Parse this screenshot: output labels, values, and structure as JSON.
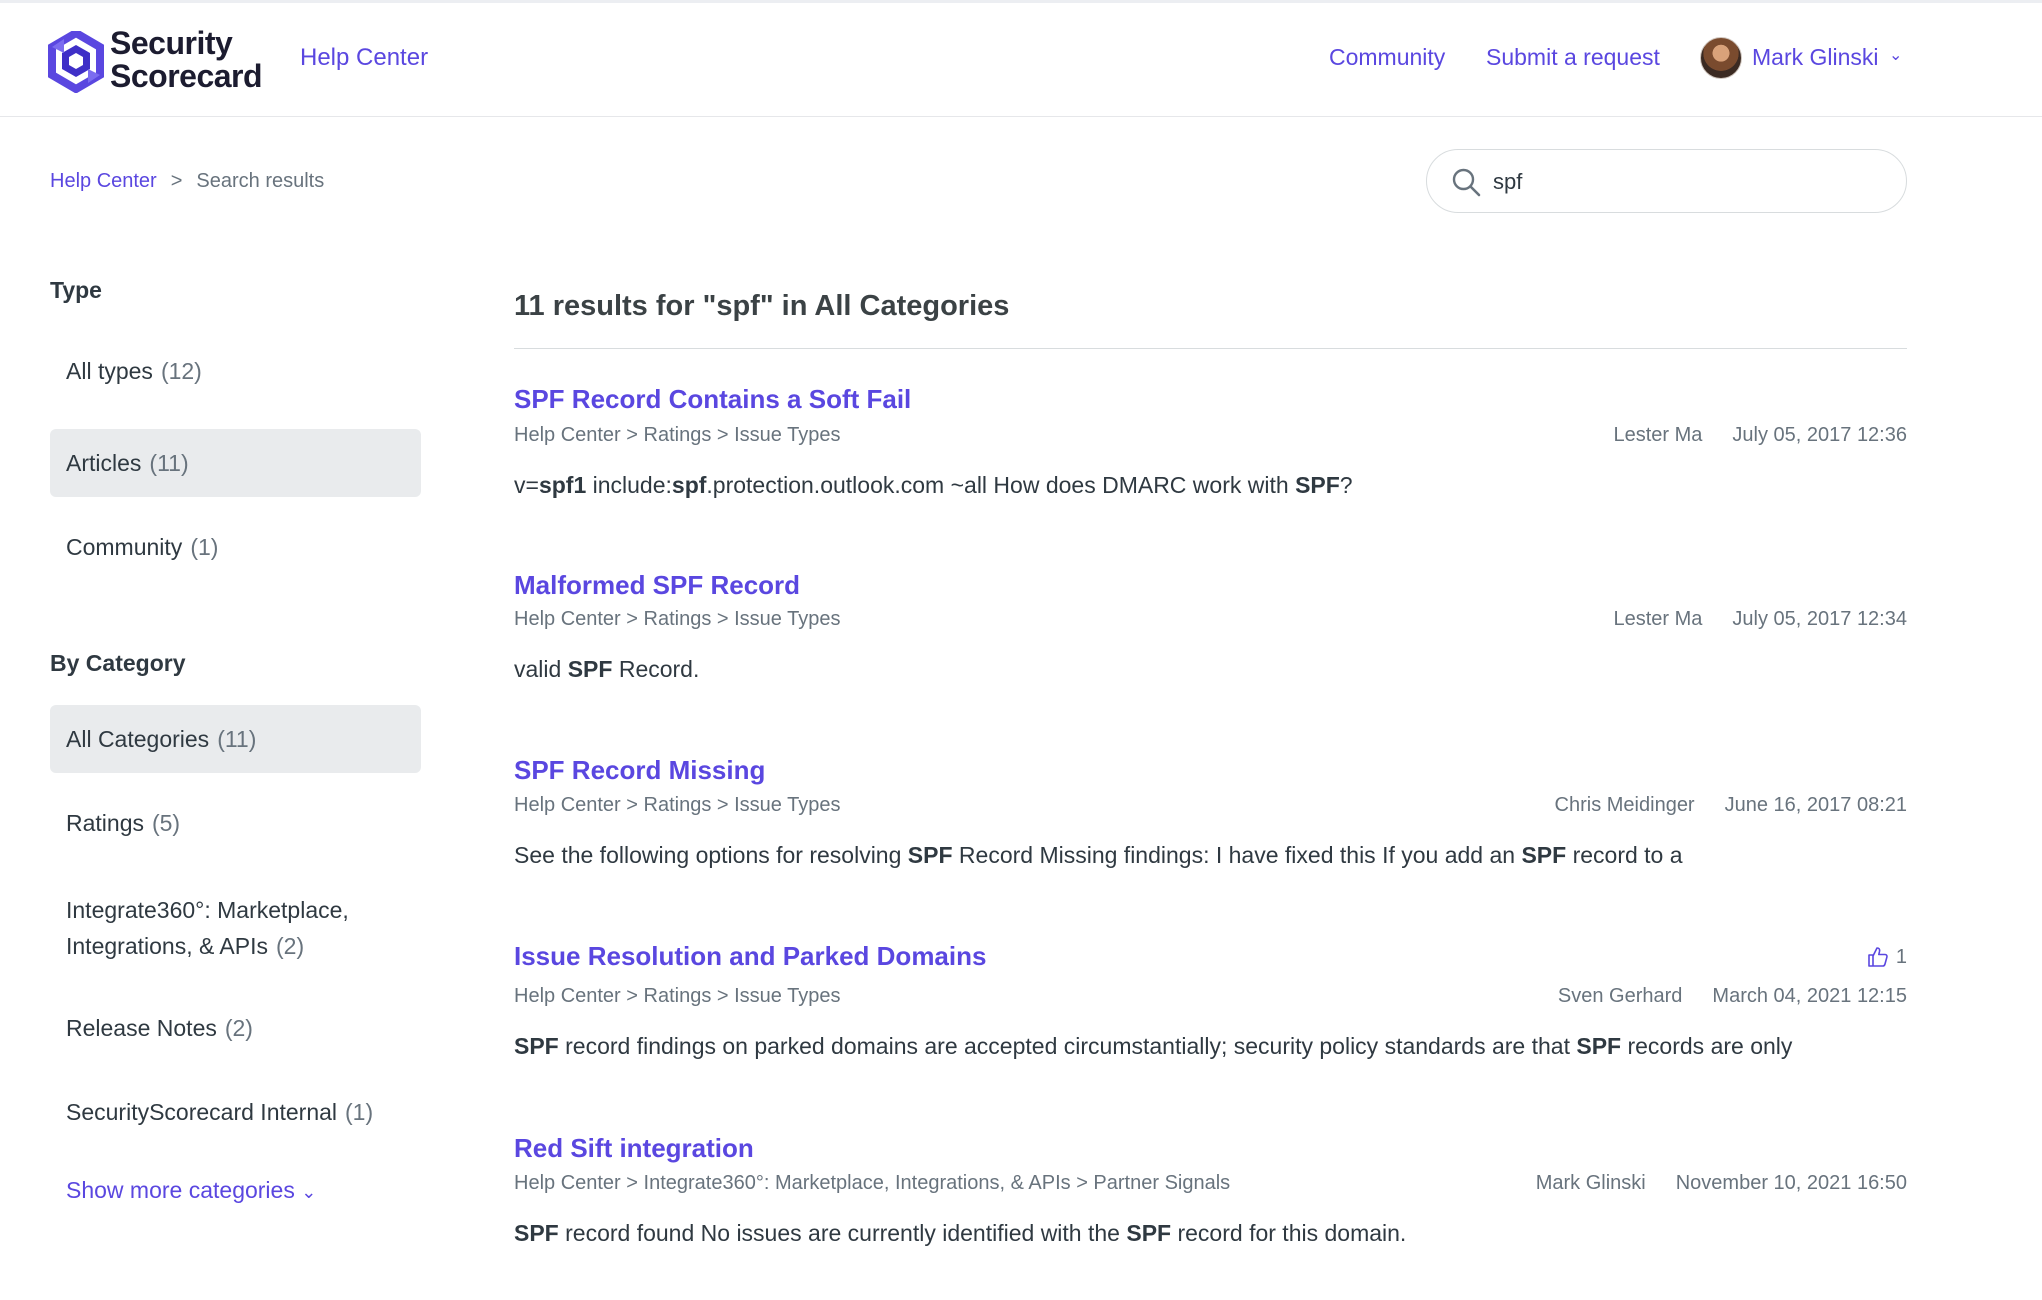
{
  "header": {
    "logo_line1": "Security",
    "logo_line2": "Scorecard",
    "help_center": "Help Center",
    "nav_community": "Community",
    "nav_submit": "Submit a request",
    "user_name": "Mark Glinski",
    "user_caret": "⌄"
  },
  "breadcrumb": {
    "home": "Help Center",
    "separator": ">",
    "current": "Search results"
  },
  "search": {
    "value": "spf",
    "icon": "search-icon"
  },
  "sidebar": {
    "type_heading": "Type",
    "types": [
      {
        "label": "All types",
        "count": "(12)",
        "active": false
      },
      {
        "label": "Articles",
        "count": "(11)",
        "active": true
      },
      {
        "label": "Community",
        "count": "(1)",
        "active": false
      }
    ],
    "category_heading": "By Category",
    "categories": [
      {
        "label": "All Categories",
        "count": "(11)",
        "active": true
      },
      {
        "label": "Ratings",
        "count": "(5)",
        "active": false
      },
      {
        "label_line1": "Integrate360°: Marketplace,",
        "label_line2": "Integrations, & APIs",
        "count": "(2)",
        "active": false
      },
      {
        "label": "Release Notes",
        "count": "(2)",
        "active": false
      },
      {
        "label": "SecurityScorecard Internal",
        "count": "(1)",
        "active": false
      }
    ],
    "show_more": "Show more categories",
    "show_more_caret": "⌄"
  },
  "main": {
    "results_title": "11 results for \"spf\" in All Categories",
    "results": [
      {
        "title": "SPF Record Contains a Soft Fail",
        "path": "Help Center > Ratings > Issue Types",
        "author": "Lester Ma",
        "date": "July 05, 2017 12:36",
        "snippet": [
          "v=",
          "spf1",
          " include:",
          "spf",
          ".protection.outlook.com ~all How does DMARC work with ",
          "SPF",
          "?"
        ]
      },
      {
        "title": "Malformed SPF Record",
        "path": "Help Center > Ratings > Issue Types",
        "author": "Lester Ma",
        "date": "July 05, 2017 12:34",
        "snippet": [
          "valid ",
          "SPF",
          " Record."
        ]
      },
      {
        "title": "SPF Record Missing",
        "path": "Help Center > Ratings > Issue Types",
        "author": "Chris Meidinger",
        "date": "June 16, 2017 08:21",
        "snippet": [
          "See the following options for resolving ",
          "SPF",
          " Record Missing findings: I have fixed this If you add an ",
          "SPF",
          " record to a"
        ]
      },
      {
        "title": "Issue Resolution and Parked Domains",
        "path": "Help Center > Ratings > Issue Types",
        "author": "Sven Gerhard",
        "date": "March 04, 2021 12:15",
        "votes": "1",
        "vote_icon": "thumbs-up-icon",
        "snippet": [
          "",
          "SPF",
          " record findings on parked domains are accepted circumstantially; security policy standards are that ",
          "SPF",
          " records are only"
        ]
      },
      {
        "title": "Red Sift integration",
        "path": "Help Center > Integrate360°: Marketplace, Integrations, & APIs > Partner Signals",
        "author": "Mark Glinski",
        "date": "November 10, 2021 16:50",
        "snippet": [
          "",
          "SPF",
          " record found No issues are currently identified with the ",
          "SPF",
          " record for this domain."
        ]
      }
    ]
  },
  "colors": {
    "brand": "#5a47e0",
    "text": "#2f3941",
    "muted": "#68737d",
    "active_bg": "#e9ebed"
  }
}
